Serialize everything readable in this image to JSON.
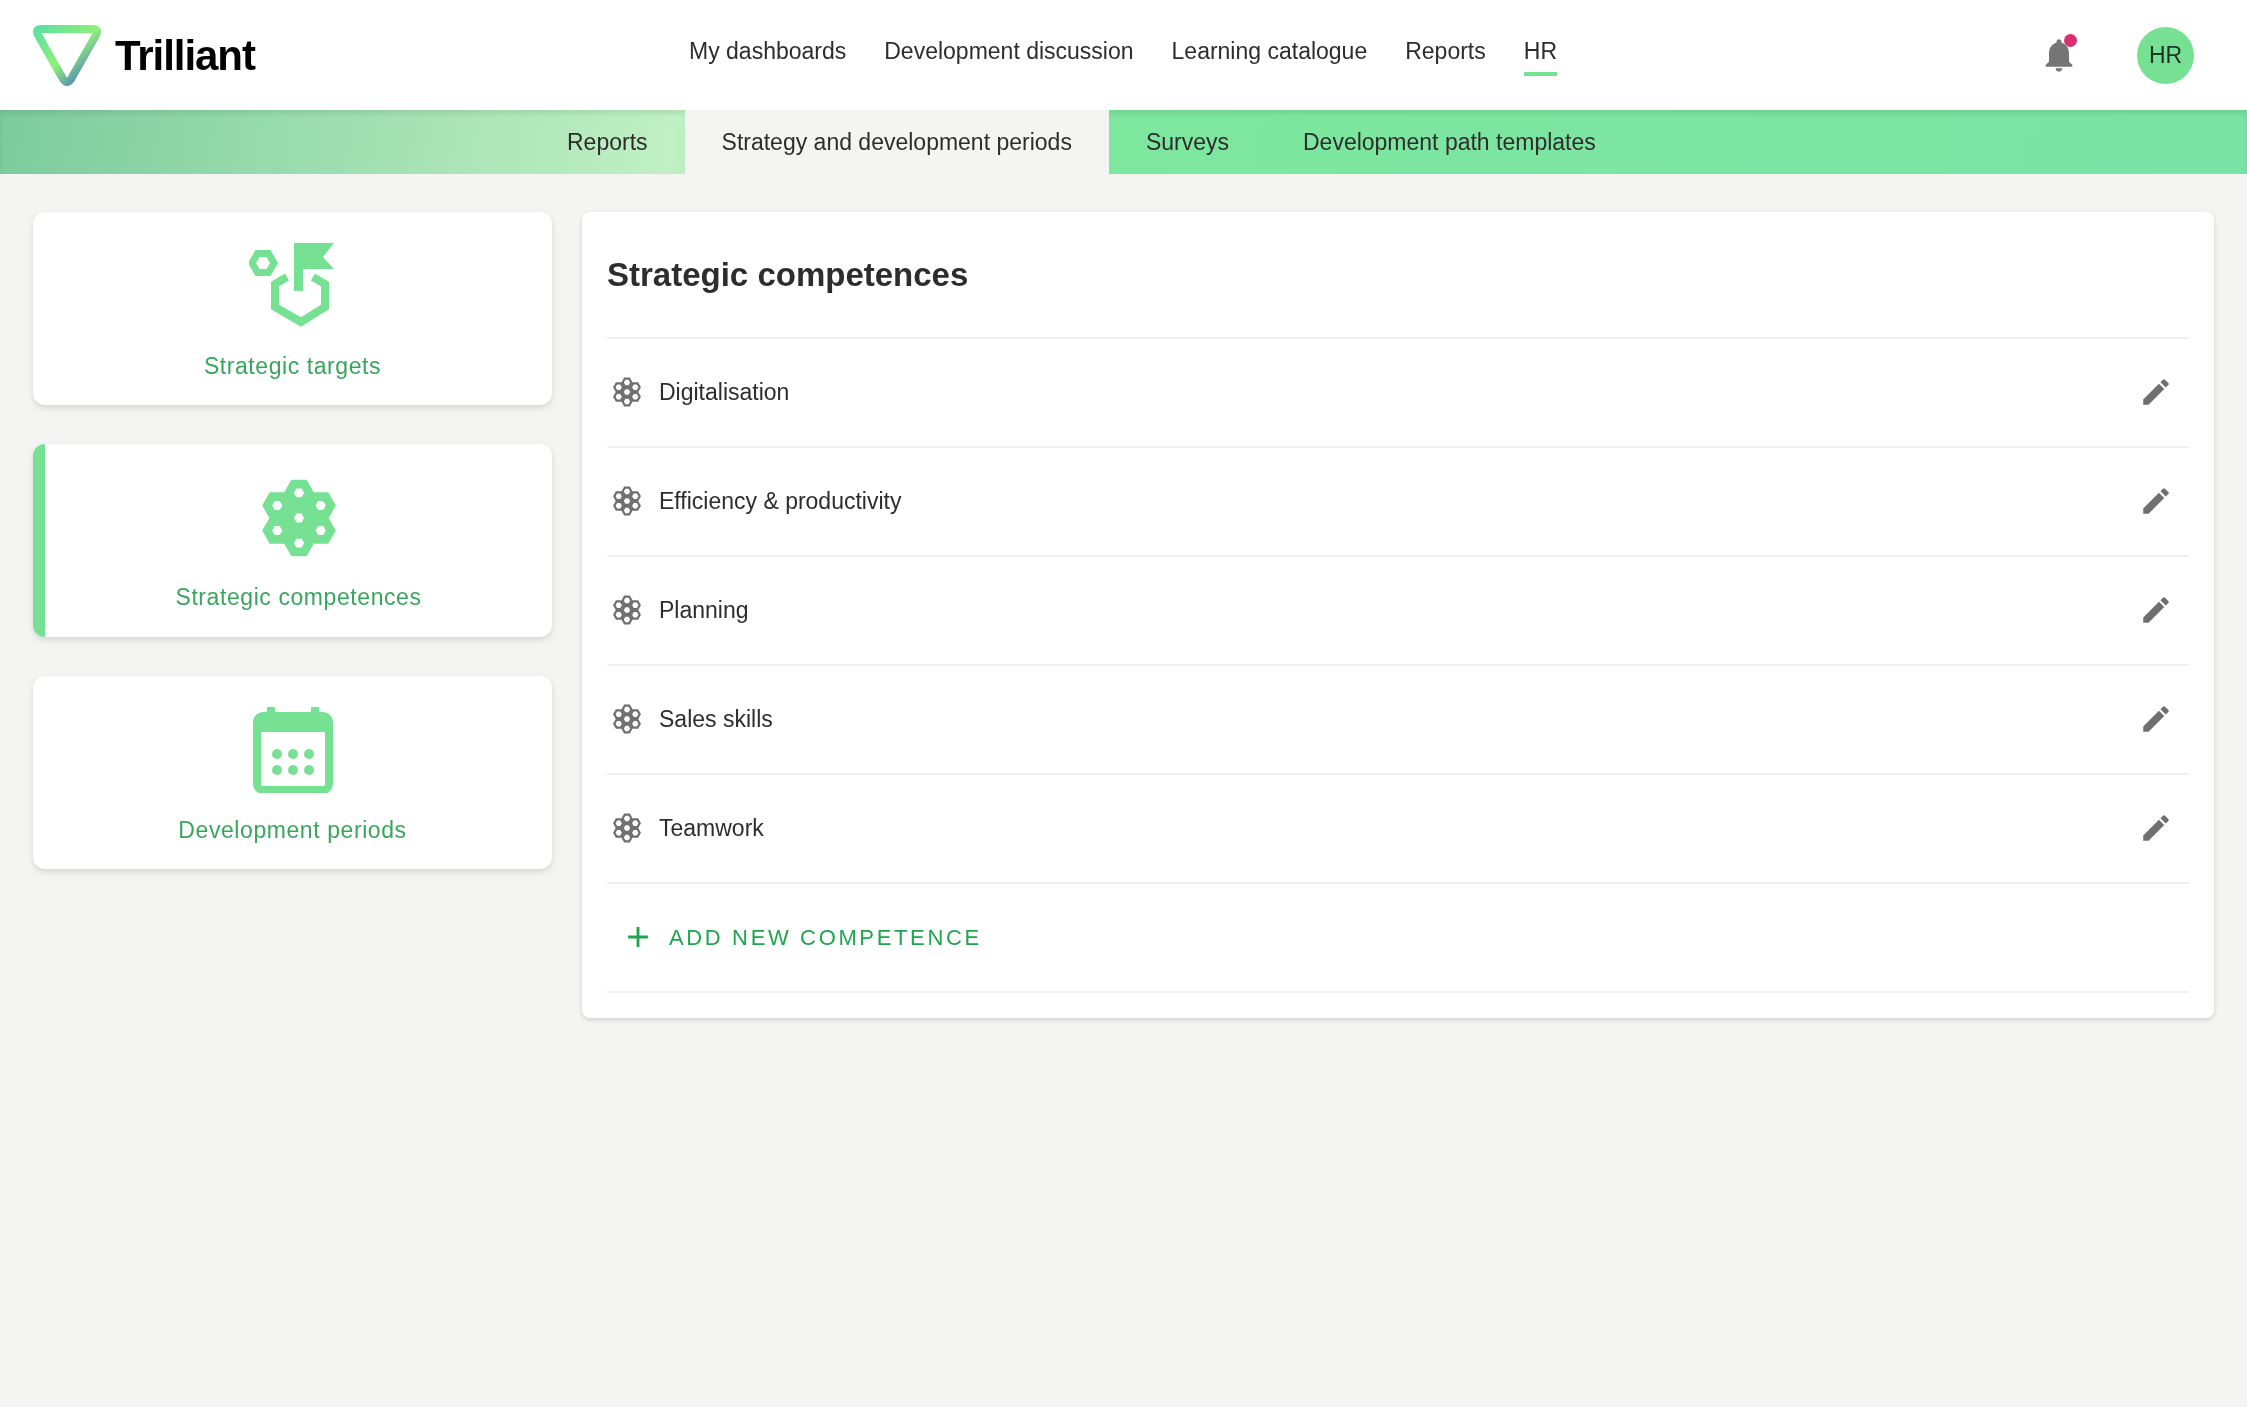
{
  "brand": {
    "name": "Trilliant"
  },
  "top_nav": [
    {
      "label": "My dashboards",
      "selected": false
    },
    {
      "label": "Development discussion",
      "selected": false
    },
    {
      "label": "Learning catalogue",
      "selected": false
    },
    {
      "label": "Reports",
      "selected": false
    },
    {
      "label": "HR",
      "selected": true
    }
  ],
  "notifications": {
    "unread": true
  },
  "user": {
    "initials": "HR"
  },
  "sub_nav": [
    {
      "label": "Reports",
      "selected": false
    },
    {
      "label": "Strategy and development periods",
      "selected": true
    },
    {
      "label": "Surveys",
      "selected": false
    },
    {
      "label": "Development path templates",
      "selected": false
    }
  ],
  "sidebar": {
    "items": [
      {
        "kind": "targets",
        "label": "Strategic targets",
        "selected": false
      },
      {
        "kind": "competences",
        "label": "Strategic competences",
        "selected": true
      },
      {
        "kind": "periods",
        "label": "Development periods",
        "selected": false
      }
    ]
  },
  "panel": {
    "title": "Strategic competences",
    "rows": [
      {
        "name": "Digitalisation"
      },
      {
        "name": "Efficiency & productivity"
      },
      {
        "name": "Planning"
      },
      {
        "name": "Sales skills"
      },
      {
        "name": "Teamwork"
      }
    ],
    "add_button": "ADD NEW COMPETENCE"
  }
}
